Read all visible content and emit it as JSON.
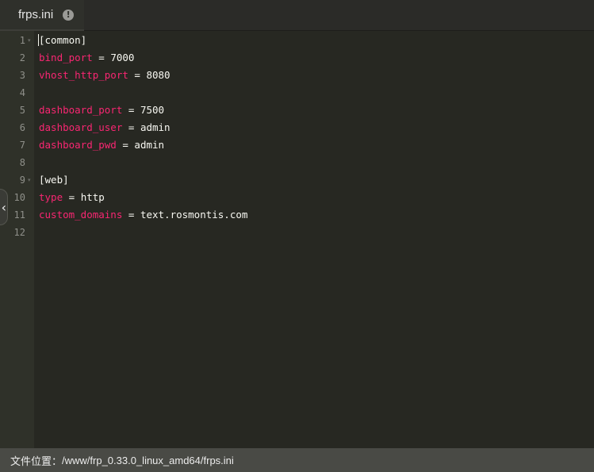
{
  "tab": {
    "title": "frps.ini",
    "close_icon": "!"
  },
  "editor": {
    "lines": [
      {
        "num": "1",
        "fold": true,
        "section": "[common]"
      },
      {
        "num": "2",
        "key": "bind_port",
        "op": " = ",
        "value": "7000"
      },
      {
        "num": "3",
        "key": "vhost_http_port",
        "op": " = ",
        "value": "8080"
      },
      {
        "num": "4"
      },
      {
        "num": "5",
        "key": "dashboard_port",
        "op": " = ",
        "value": "7500"
      },
      {
        "num": "6",
        "key": "dashboard_user",
        "op": " = ",
        "value": "admin"
      },
      {
        "num": "7",
        "key": "dashboard_pwd",
        "op": " = ",
        "value": "admin"
      },
      {
        "num": "8"
      },
      {
        "num": "9",
        "fold": true,
        "section": "[web]"
      },
      {
        "num": "10",
        "key": "type",
        "op": " = ",
        "value": "http"
      },
      {
        "num": "11",
        "key": "custom_domains",
        "op": " = ",
        "value": "text.rosmontis.com"
      },
      {
        "num": "12"
      }
    ],
    "fold_glyph": "▾",
    "collapse_glyph": "‹"
  },
  "statusbar": {
    "label": "文件位置：",
    "path": "/www/frp_0.33.0_linux_amd64/frps.ini"
  }
}
